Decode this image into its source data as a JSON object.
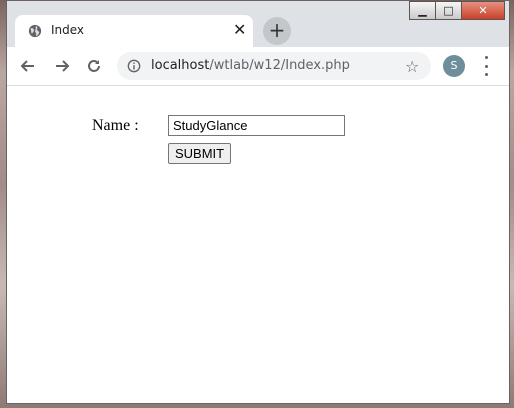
{
  "window_controls": [
    "minimize-icon",
    "maximize-icon",
    "close-icon"
  ],
  "tab": {
    "title": "Index",
    "icon": "globe-icon"
  },
  "toolbar": {
    "url_host": "localhost",
    "url_path": "/wtlab/w12/Index.php",
    "profile_initial": "S",
    "colors": {
      "profile": "#6d8e9a"
    }
  },
  "form": {
    "name_label": "Name :",
    "name_value": "StudyGlance",
    "submit_label": "SUBMIT"
  }
}
